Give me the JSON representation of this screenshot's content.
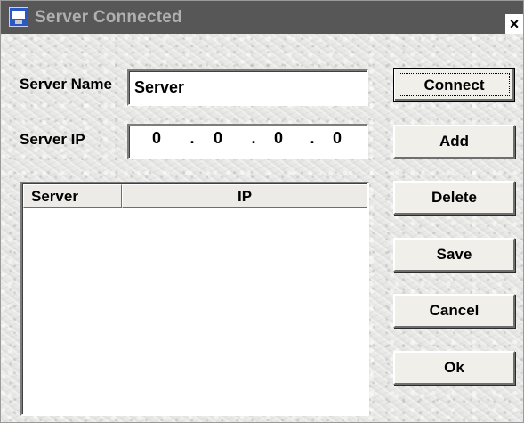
{
  "window": {
    "title": "Server Connected",
    "close_glyph": "×",
    "icon": "monitor-app-icon"
  },
  "form": {
    "server_name_label": "Server Name",
    "server_name_value": "Server",
    "server_ip_label": "Server IP",
    "ip_octets": [
      "0",
      "0",
      "0",
      "0"
    ],
    "ip_separator": "."
  },
  "list": {
    "columns": [
      "Server",
      "IP"
    ],
    "rows": []
  },
  "buttons": {
    "connect": "Connect",
    "add": "Add",
    "delete": "Delete",
    "save": "Save",
    "cancel": "Cancel",
    "ok": "Ok"
  }
}
